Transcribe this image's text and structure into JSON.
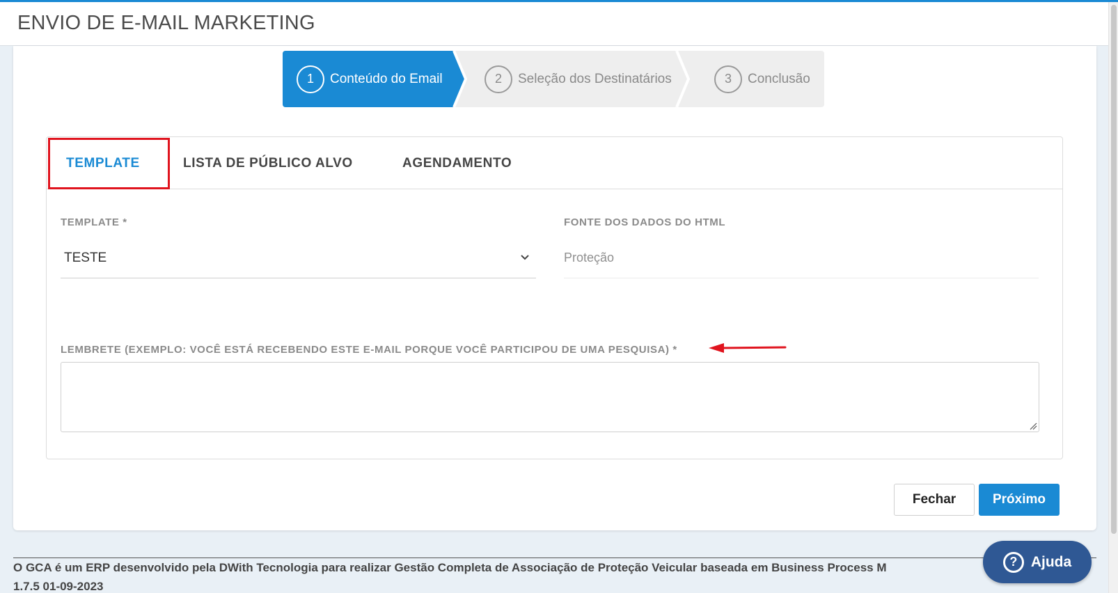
{
  "header": {
    "title": "ENVIO DE E-MAIL MARKETING"
  },
  "wizard": {
    "steps": [
      {
        "number": "1",
        "label": "Conteúdo do Email"
      },
      {
        "number": "2",
        "label": "Seleção dos Destinatários"
      },
      {
        "number": "3",
        "label": "Conclusão"
      }
    ],
    "active_step": 1
  },
  "tabs": [
    {
      "label": "TEMPLATE"
    },
    {
      "label": "LISTA DE PÚBLICO ALVO"
    },
    {
      "label": "AGENDAMENTO"
    }
  ],
  "form": {
    "template": {
      "label": "TEMPLATE  *",
      "value": "TESTE"
    },
    "fonte": {
      "label": "FONTE DOS DADOS DO HTML",
      "value": "Proteção"
    },
    "lembrete": {
      "label": "LEMBRETE (EXEMPLO: VOCÊ ESTÁ RECEBENDO ESTE E-MAIL PORQUE VOCÊ PARTICIPOU DE UMA PESQUISA)  *",
      "value": ""
    }
  },
  "buttons": {
    "fechar": "Fechar",
    "proximo": "Próximo"
  },
  "footer": {
    "text": "O GCA é um ERP desenvolvido pela DWith Tecnologia para realizar Gestão Completa de Associação de Proteção Veicular baseada em Business Process M",
    "version": "1.7.5 01-09-2023"
  },
  "help": {
    "label": "Ajuda"
  },
  "colors": {
    "primary": "#1a8ad4",
    "annotation_red": "#e0141e",
    "help_button": "#2f5894"
  }
}
